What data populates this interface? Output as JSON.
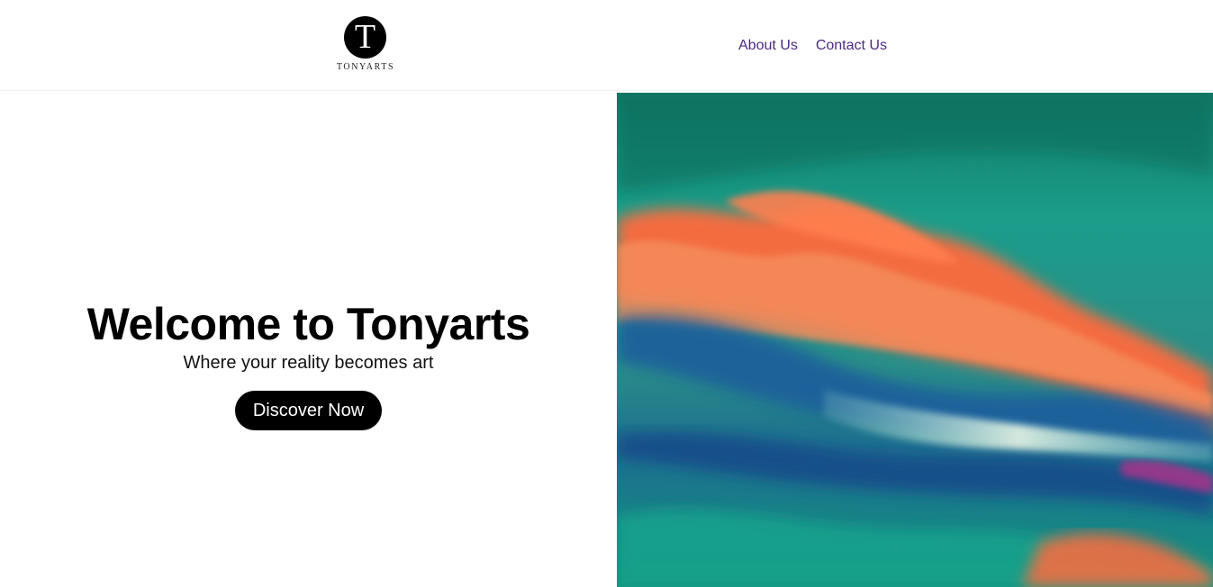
{
  "header": {
    "logo": {
      "letter": "T",
      "wordmark": "TONYARTS"
    },
    "nav": [
      {
        "label": "About Us"
      },
      {
        "label": "Contact Us"
      }
    ],
    "colors": {
      "nav_link": "#4b2a80"
    }
  },
  "hero": {
    "title": "Welcome to Tonyarts",
    "subtitle": "Where your reality becomes art",
    "cta_label": "Discover Now",
    "image": {
      "description": "abstract-painting-clouds",
      "palette": [
        "#0f7f6d",
        "#1aa290",
        "#ff6a3d",
        "#f49a6c",
        "#1d5f9c",
        "#7fd1c0"
      ]
    }
  }
}
